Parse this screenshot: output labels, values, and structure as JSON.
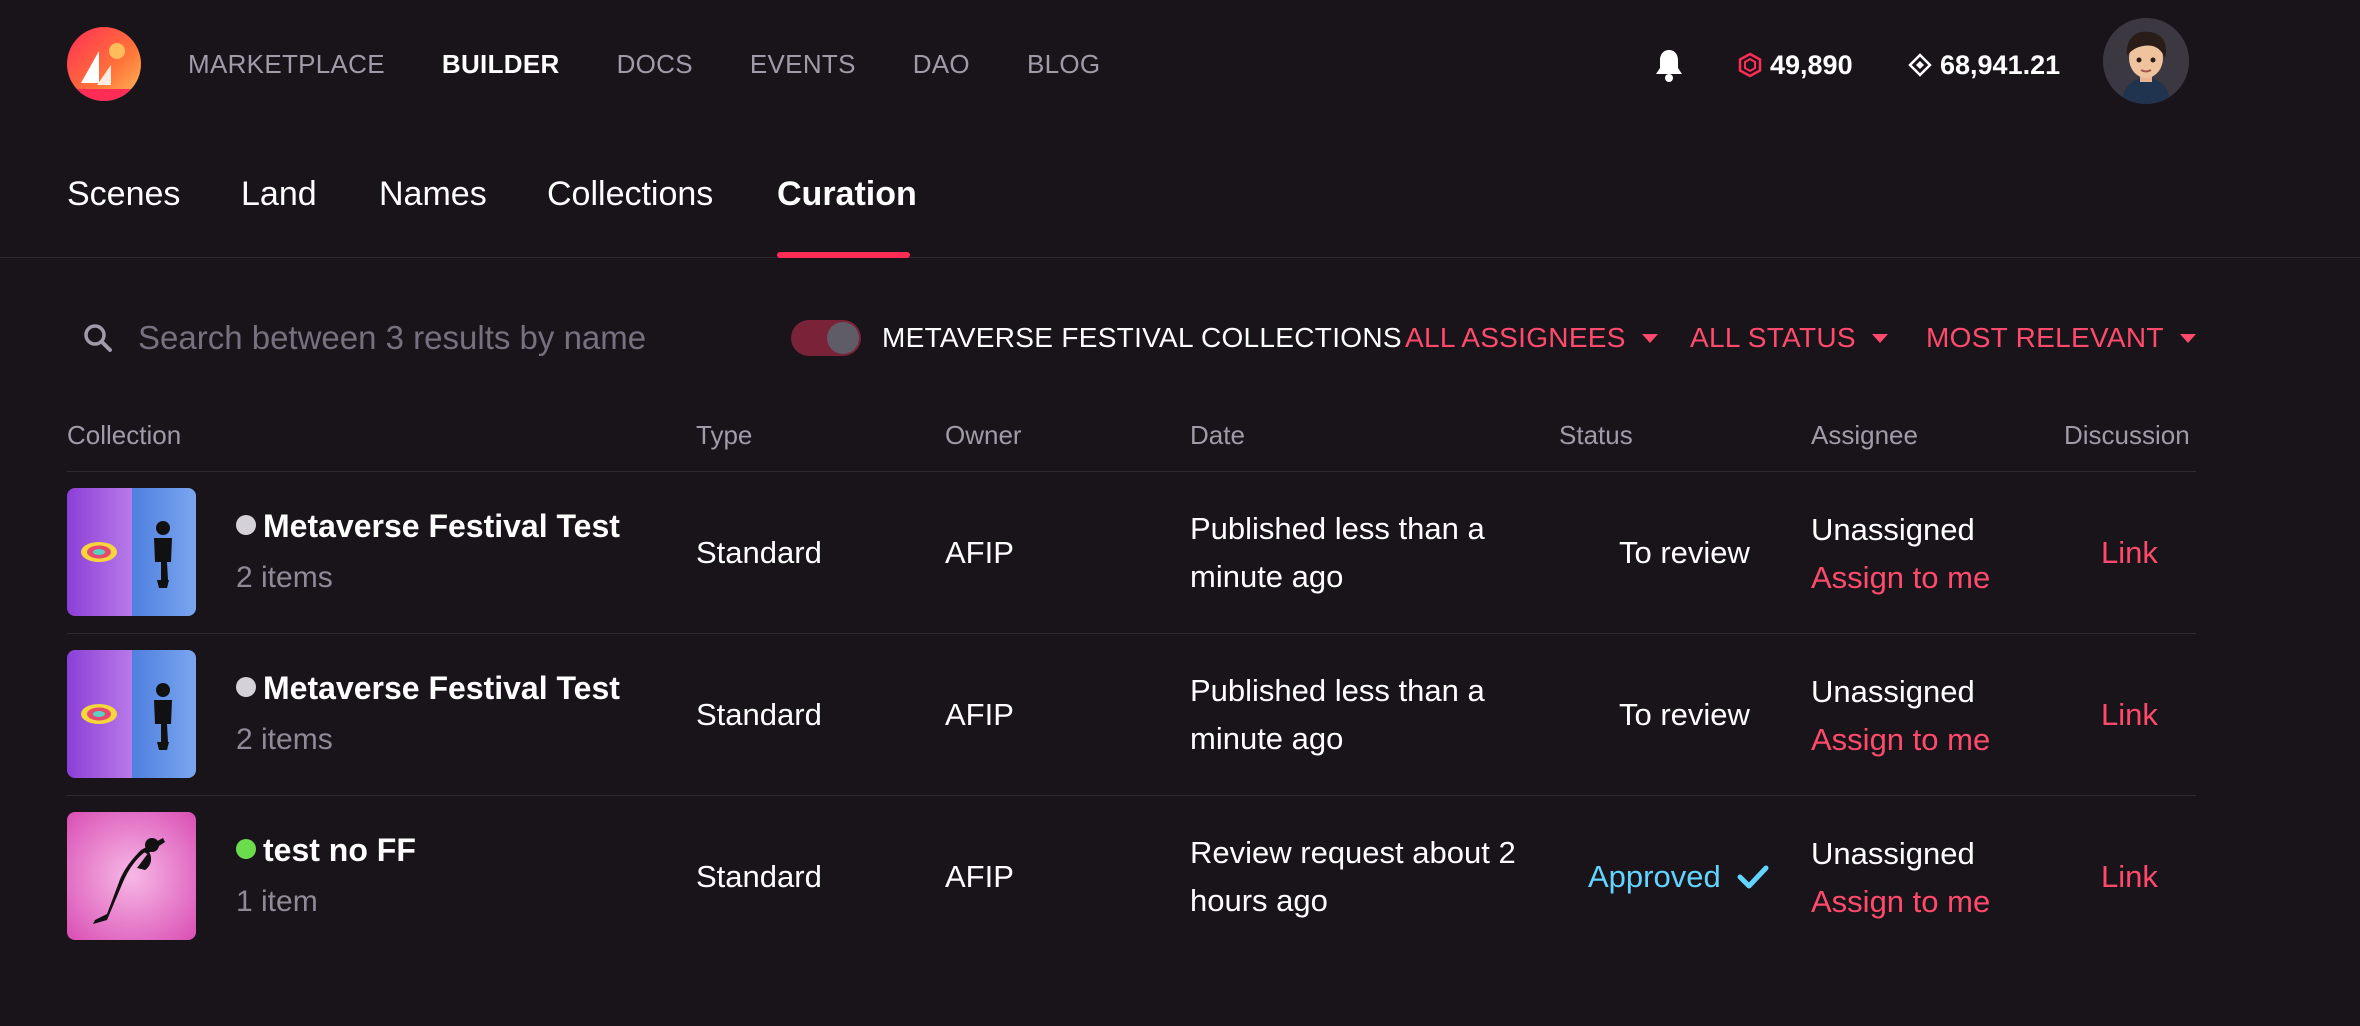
{
  "nav": {
    "links": [
      "MARKETPLACE",
      "BUILDER",
      "DOCS",
      "EVENTS",
      "DAO",
      "BLOG"
    ],
    "active": "BUILDER",
    "mana_ethereum": "49,890",
    "mana_polygon": "68,941.21",
    "icons": {
      "notifications": "bell-icon",
      "mana_eth": "mana-hexagon-icon",
      "mana_polygon": "mana-diamond-icon"
    }
  },
  "tabs": {
    "items": [
      "Scenes",
      "Land",
      "Names",
      "Collections",
      "Curation"
    ],
    "active": "Curation"
  },
  "filters": {
    "search_placeholder": "Search between 3 results by name",
    "toggle_label": "METAVERSE FESTIVAL COLLECTIONS",
    "toggle_on": true,
    "assignees": "ALL ASSIGNEES",
    "status": "ALL STATUS",
    "sort": "MOST RELEVANT"
  },
  "table": {
    "headers": [
      "Collection",
      "Type",
      "Owner",
      "Date",
      "Status",
      "Assignee",
      "Discussion"
    ],
    "rows": [
      {
        "name": "Metaverse Festival Test",
        "items": "2 items",
        "type": "Standard",
        "owner": "AFIP",
        "date": "Published less than a minute ago",
        "status": "To review",
        "assignee": "Unassigned",
        "assign_action": "Assign to me",
        "discussion": "Link",
        "dot_color": "#d4d2d8"
      },
      {
        "name": "Metaverse Festival Test",
        "items": "2 items",
        "type": "Standard",
        "owner": "AFIP",
        "date": "Published less than a minute ago",
        "status": "To review",
        "assignee": "Unassigned",
        "assign_action": "Assign to me",
        "discussion": "Link",
        "dot_color": "#d4d2d8"
      },
      {
        "name": "test no FF",
        "items": "1 item",
        "type": "Standard",
        "owner": "AFIP",
        "date": "Review request about 2 hours ago",
        "status": "Approved",
        "assignee": "Unassigned",
        "assign_action": "Assign to me",
        "discussion": "Link",
        "dot_color": "#6bdc4b"
      }
    ]
  },
  "colors": {
    "background": "#18141a",
    "accent": "#ff2d55",
    "link": "#ff4a6c",
    "approved": "#63d4ff"
  }
}
